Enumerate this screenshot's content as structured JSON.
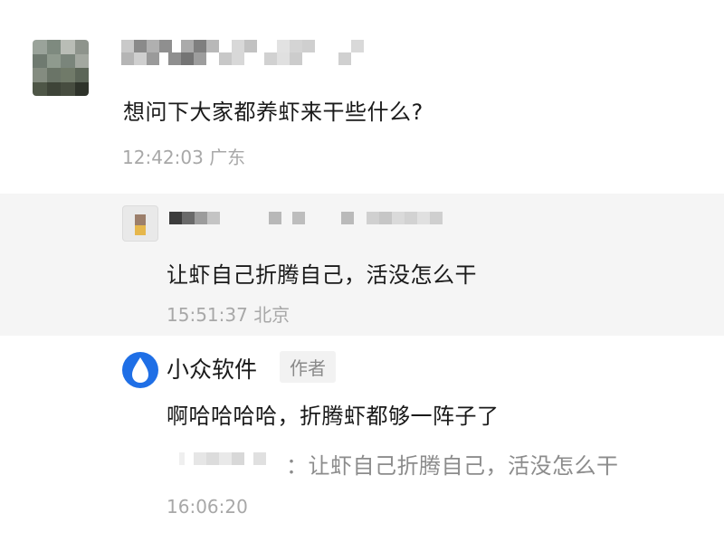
{
  "post": {
    "content": "想问下大家都养虾来干些什么?",
    "time": "12:42:03",
    "location": "广东"
  },
  "reply": {
    "content": "让虾自己折腾自己，活没怎么干",
    "time": "15:51:37",
    "location": "北京"
  },
  "author_reply": {
    "name": "小众软件",
    "badge": "作者",
    "content": "啊哈哈哈哈，折腾虾都够一阵子了",
    "quote_separator": "：",
    "quote": "让虾自己折腾自己，活没怎么干",
    "time": "16:06:20"
  },
  "colors": {
    "meta_gray": "#a8a8a8",
    "reply_background": "#f5f5f5",
    "brand_blue": "#1f6fe6"
  },
  "icons": {
    "author_logo": "water-drop-icon"
  }
}
